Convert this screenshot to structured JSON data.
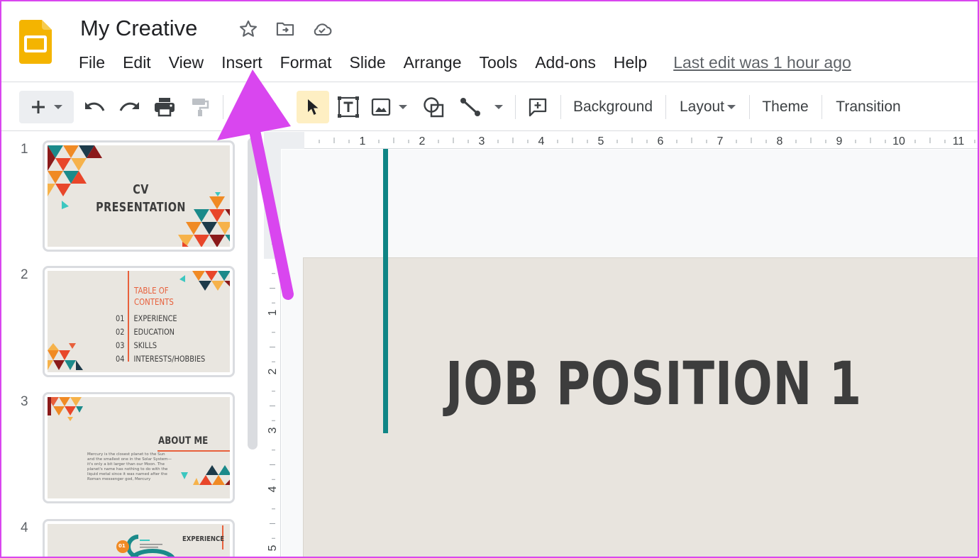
{
  "document": {
    "title": "My Creative",
    "last_edit": "Last edit was 1 hour ago"
  },
  "menu": {
    "items": [
      "File",
      "Edit",
      "View",
      "Insert",
      "Format",
      "Slide",
      "Arrange",
      "Tools",
      "Add-ons",
      "Help"
    ]
  },
  "toolbar": {
    "background_label": "Background",
    "layout_label": "Layout",
    "theme_label": "Theme",
    "transition_label": "Transition"
  },
  "ruler": {
    "horizontal_ticks": [
      "1",
      "2",
      "3",
      "4",
      "5",
      "6",
      "7",
      "8",
      "9",
      "10",
      "11"
    ],
    "vertical_ticks": [
      "1",
      "2",
      "3",
      "4",
      "5"
    ]
  },
  "slides": [
    {
      "number": "1",
      "title": "CV",
      "subtitle": "PRESENTATION"
    },
    {
      "number": "2",
      "title_line1": "TABLE OF",
      "title_line2": "CONTENTS",
      "items": [
        {
          "num": "01",
          "label": "EXPERIENCE"
        },
        {
          "num": "02",
          "label": "EDUCATION"
        },
        {
          "num": "03",
          "label": "SKILLS"
        },
        {
          "num": "04",
          "label": "INTERESTS/HOBBIES"
        }
      ]
    },
    {
      "number": "3",
      "title": "ABOUT ME",
      "body": "Mercury is the closest planet to the Sun and the smallest one in the Solar System—it's only a bit larger than our Moon. The planet's name has nothing to do with the liquid metal since it was named after the Roman messenger god, Mercury"
    },
    {
      "number": "4",
      "title": "EXPERIENCE",
      "badge": "01"
    }
  ],
  "current_slide": {
    "title": "JOB POSITION 1"
  },
  "colors": {
    "accent_teal": "#0f8585",
    "annotation_arrow": "#d946ef",
    "slide_bg": "#e8e4de",
    "slides_logo": "#f4b400"
  },
  "icons": [
    "slides-logo",
    "star-icon",
    "move-to-folder-icon",
    "cloud-saved-icon",
    "plus-icon",
    "undo-icon",
    "redo-icon",
    "print-icon",
    "paint-format-icon",
    "zoom-icon",
    "select-icon",
    "text-box-icon",
    "image-icon",
    "shape-icon",
    "line-icon",
    "comment-icon"
  ]
}
